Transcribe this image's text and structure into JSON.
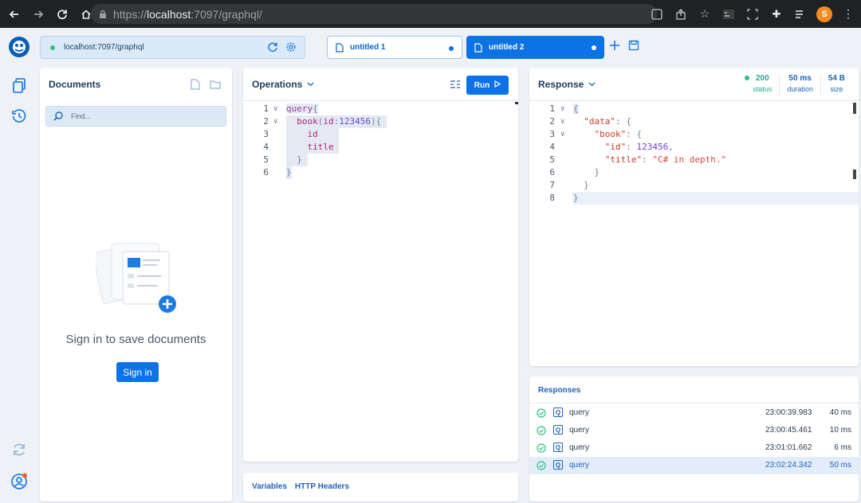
{
  "browser": {
    "url_prefix": "https://",
    "url_host": "localhost",
    "url_rest": ":7097/graphql/",
    "profile_initial": "S"
  },
  "endpoint": {
    "url": "localhost:7097/graphql"
  },
  "tabs": [
    {
      "label": "untitled 1"
    },
    {
      "label": "untitled 2"
    }
  ],
  "documents": {
    "title": "Documents",
    "find_placeholder": "Find...",
    "signin_text": "Sign in to save documents",
    "signin_button": "Sign in"
  },
  "operations": {
    "title": "Operations",
    "run_label": "Run",
    "line_numbers": [
      "1",
      "2",
      "3",
      "4",
      "5",
      "6"
    ]
  },
  "bottom_tabs": {
    "variables": "Variables",
    "http_headers": "HTTP Headers"
  },
  "response": {
    "title": "Response",
    "status_value": "200",
    "status_label": "status",
    "duration_value": "50 ms",
    "duration_label": "duration",
    "size_value": "54 B",
    "size_label": "size",
    "line_numbers": [
      "1",
      "2",
      "3",
      "4",
      "5",
      "6",
      "7",
      "8"
    ],
    "body": {
      "book_id": "123456",
      "book_title": "\"C# in depth.\""
    }
  },
  "responses": {
    "title": "Responses",
    "items": [
      {
        "op": "query",
        "time": "23:00:39.983",
        "duration": "40 ms"
      },
      {
        "op": "query",
        "time": "23:00:45.461",
        "duration": "10 ms"
      },
      {
        "op": "query",
        "time": "23:01:01.662",
        "duration": "6 ms"
      },
      {
        "op": "query",
        "time": "23:02:24.342",
        "duration": "50 ms"
      }
    ]
  },
  "colors": {
    "accent": "#0b73e6",
    "success": "#2ec27e",
    "background": "#eef1f6"
  }
}
